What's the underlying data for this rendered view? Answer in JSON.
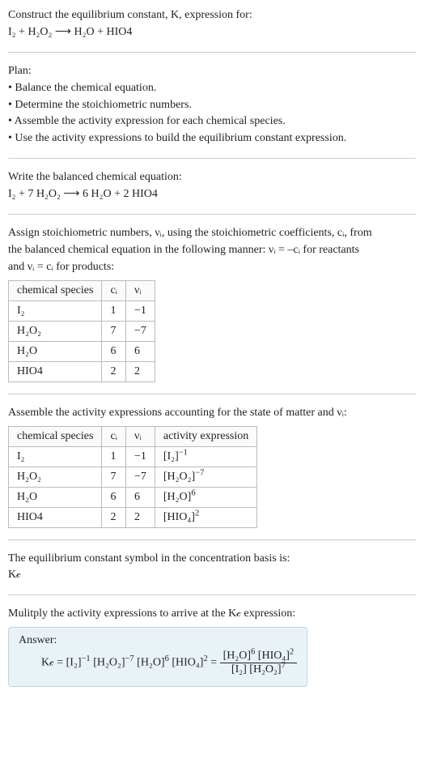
{
  "intro_line1": "Construct the equilibrium constant, K, expression for:",
  "intro_eq": "I₂ + H₂O₂ ⟶ H₂O + HIO4",
  "plan_heading": "Plan:",
  "plan_b1": "• Balance the chemical equation.",
  "plan_b2": "• Determine the stoichiometric numbers.",
  "plan_b3": "• Assemble the activity expression for each chemical species.",
  "plan_b4": "• Use the activity expressions to build the equilibrium constant expression.",
  "balanced_heading": "Write the balanced chemical equation:",
  "balanced_eq": "I₂ + 7 H₂O₂ ⟶ 6 H₂O + 2 HIO4",
  "assign_heading_l1": "Assign stoichiometric numbers, νᵢ, using the stoichiometric coefficients, cᵢ, from",
  "assign_heading_l2": "the balanced chemical equation in the following manner: νᵢ = –cᵢ for reactants",
  "assign_heading_l3": "and νᵢ = cᵢ for products:",
  "t1": {
    "h_species": "chemical species",
    "h_ci": "cᵢ",
    "h_vi": "νᵢ",
    "rows": [
      {
        "sp": "I₂",
        "ci": "1",
        "vi": "−1"
      },
      {
        "sp": "H₂O₂",
        "ci": "7",
        "vi": "−7"
      },
      {
        "sp": "H₂O",
        "ci": "6",
        "vi": "6"
      },
      {
        "sp": "HIO4",
        "ci": "2",
        "vi": "2"
      }
    ]
  },
  "assemble_heading": "Assemble the activity expressions accounting for the state of matter and νᵢ:",
  "t2": {
    "h_species": "chemical species",
    "h_ci": "cᵢ",
    "h_vi": "νᵢ",
    "h_act": "activity expression",
    "rows": [
      {
        "sp": "I₂",
        "ci": "1",
        "vi": "−1",
        "act_base": "[I₂]",
        "act_exp": "−1"
      },
      {
        "sp": "H₂O₂",
        "ci": "7",
        "vi": "−7",
        "act_base": "[H₂O₂]",
        "act_exp": "−7"
      },
      {
        "sp": "H₂O",
        "ci": "6",
        "vi": "6",
        "act_base": "[H₂O]",
        "act_exp": "6"
      },
      {
        "sp": "HIO4",
        "ci": "2",
        "vi": "2",
        "act_base": "[HIO₄]",
        "act_exp": "2"
      }
    ]
  },
  "basis_line1": "The equilibrium constant symbol in the concentration basis is:",
  "basis_line2": "K𝒸",
  "mult_line": "Mulitply the activity expressions to arrive at the K𝒸 expression:",
  "answer_label": "Answer:",
  "answer_prefix": "K𝒸 = ",
  "answer_term1_base": "[I₂]",
  "answer_term1_exp": "−1",
  "answer_term2_base": "[H₂O₂]",
  "answer_term2_exp": "−7",
  "answer_term3_base": "[H₂O]",
  "answer_term3_exp": "6",
  "answer_term4_base": "[HIO₄]",
  "answer_term4_exp": "2",
  "answer_eq": " = ",
  "answer_num_t1_base": "[H₂O]",
  "answer_num_t1_exp": "6",
  "answer_num_t2_base": "[HIO₄]",
  "answer_num_t2_exp": "2",
  "answer_den_t1": "[I₂] ",
  "answer_den_t2_base": "[H₂O₂]",
  "answer_den_t2_exp": "7"
}
